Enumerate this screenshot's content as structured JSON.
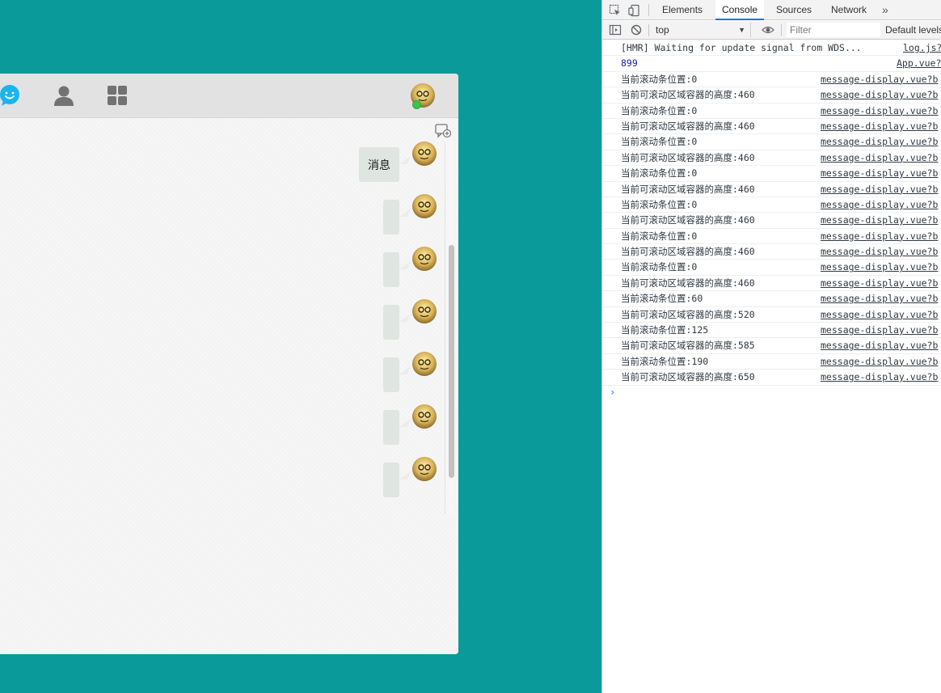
{
  "app": {
    "header": {
      "icons": [
        "chat-bubble-icon",
        "contact-person-icon",
        "apps-grid-icon"
      ],
      "user_status": "online"
    },
    "chat": {
      "messages": [
        {
          "sender": "self",
          "text": "消息"
        },
        {
          "sender": "self",
          "text": ""
        },
        {
          "sender": "self",
          "text": ""
        },
        {
          "sender": "self",
          "text": ""
        },
        {
          "sender": "self",
          "text": ""
        },
        {
          "sender": "self",
          "text": ""
        },
        {
          "sender": "self",
          "text": ""
        }
      ]
    },
    "colors": {
      "background": "#0a9a9a",
      "bubble": "#dfe5e0",
      "online": "#3fc34f",
      "chat_icon": "#1ab5f0"
    }
  },
  "devtools": {
    "tabs": [
      "Elements",
      "Console",
      "Sources",
      "Network"
    ],
    "active_tab": "Console",
    "more_tabs_glyph": "»",
    "context": "top",
    "filter_placeholder": "Filter",
    "levels_label": "Default levels",
    "logs": [
      {
        "message": "[HMR] Waiting for update signal from WDS...",
        "source": "log.js?",
        "kind": "text"
      },
      {
        "message": "899",
        "source": "App.vue?",
        "kind": "number"
      },
      {
        "message": "当前滚动条位置:0",
        "source": "message-display.vue?b",
        "kind": "text"
      },
      {
        "message": "当前可滚动区域容器的高度:460",
        "source": "message-display.vue?b",
        "kind": "text"
      },
      {
        "message": "当前滚动条位置:0",
        "source": "message-display.vue?b",
        "kind": "text"
      },
      {
        "message": "当前可滚动区域容器的高度:460",
        "source": "message-display.vue?b",
        "kind": "text"
      },
      {
        "message": "当前滚动条位置:0",
        "source": "message-display.vue?b",
        "kind": "text"
      },
      {
        "message": "当前可滚动区域容器的高度:460",
        "source": "message-display.vue?b",
        "kind": "text"
      },
      {
        "message": "当前滚动条位置:0",
        "source": "message-display.vue?b",
        "kind": "text"
      },
      {
        "message": "当前可滚动区域容器的高度:460",
        "source": "message-display.vue?b",
        "kind": "text"
      },
      {
        "message": "当前滚动条位置:0",
        "source": "message-display.vue?b",
        "kind": "text"
      },
      {
        "message": "当前可滚动区域容器的高度:460",
        "source": "message-display.vue?b",
        "kind": "text"
      },
      {
        "message": "当前滚动条位置:0",
        "source": "message-display.vue?b",
        "kind": "text"
      },
      {
        "message": "当前可滚动区域容器的高度:460",
        "source": "message-display.vue?b",
        "kind": "text"
      },
      {
        "message": "当前滚动条位置:0",
        "source": "message-display.vue?b",
        "kind": "text"
      },
      {
        "message": "当前可滚动区域容器的高度:460",
        "source": "message-display.vue?b",
        "kind": "text"
      },
      {
        "message": "当前滚动条位置:60",
        "source": "message-display.vue?b",
        "kind": "text"
      },
      {
        "message": "当前可滚动区域容器的高度:520",
        "source": "message-display.vue?b",
        "kind": "text"
      },
      {
        "message": "当前滚动条位置:125",
        "source": "message-display.vue?b",
        "kind": "text"
      },
      {
        "message": "当前可滚动区域容器的高度:585",
        "source": "message-display.vue?b",
        "kind": "text"
      },
      {
        "message": "当前滚动条位置:190",
        "source": "message-display.vue?b",
        "kind": "text"
      },
      {
        "message": "当前可滚动区域容器的高度:650",
        "source": "message-display.vue?b",
        "kind": "text"
      }
    ],
    "prompt_glyph": "›"
  }
}
